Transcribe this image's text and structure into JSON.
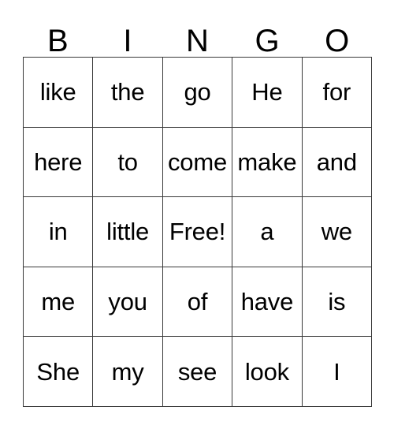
{
  "card": {
    "title": "BINGO",
    "header_letters": [
      "B",
      "I",
      "N",
      "G",
      "O"
    ],
    "free_space_label": "Free!",
    "colors": {
      "background": "#ffffff",
      "border": "#3a3a3a",
      "text": "#000000"
    },
    "rows": [
      {
        "cells": [
          {
            "text": "like"
          },
          {
            "text": "the"
          },
          {
            "text": "go"
          },
          {
            "text": "He"
          },
          {
            "text": "for"
          }
        ]
      },
      {
        "cells": [
          {
            "text": "here"
          },
          {
            "text": "to"
          },
          {
            "text": "come"
          },
          {
            "text": "make"
          },
          {
            "text": "and"
          }
        ]
      },
      {
        "cells": [
          {
            "text": "in"
          },
          {
            "text": "little"
          },
          {
            "text": "Free!"
          },
          {
            "text": "a"
          },
          {
            "text": "we"
          }
        ]
      },
      {
        "cells": [
          {
            "text": "me"
          },
          {
            "text": "you"
          },
          {
            "text": "of"
          },
          {
            "text": "have"
          },
          {
            "text": "is"
          }
        ]
      },
      {
        "cells": [
          {
            "text": "She"
          },
          {
            "text": "my"
          },
          {
            "text": "see"
          },
          {
            "text": "look"
          },
          {
            "text": "I"
          }
        ]
      }
    ]
  }
}
